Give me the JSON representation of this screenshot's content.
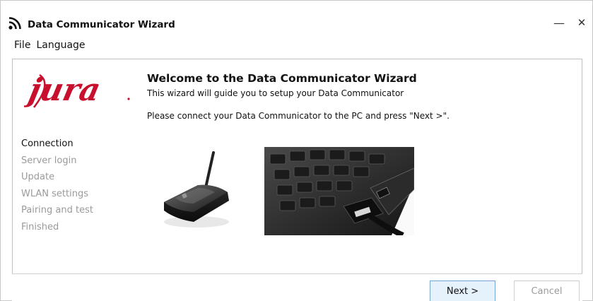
{
  "window": {
    "title": "Data Communicator Wizard",
    "icon": "rss-feed-icon",
    "minimize_glyph": "—",
    "close_glyph": "✕"
  },
  "menu": {
    "items": [
      "File",
      "Language"
    ]
  },
  "brand": {
    "logo_text": "jura",
    "logo_color": "#c8102e"
  },
  "wizard": {
    "heading": "Welcome to the Data Communicator Wizard",
    "subheading": "This wizard will guide you to setup your Data Communicator",
    "instruction": "Please connect your Data Communicator to the PC and press \"Next >\".",
    "steps": [
      {
        "label": "Connection",
        "active": true
      },
      {
        "label": "Server login",
        "active": false
      },
      {
        "label": "Update",
        "active": false
      },
      {
        "label": "WLAN settings",
        "active": false
      },
      {
        "label": "Pairing and test",
        "active": false
      },
      {
        "label": "Finished",
        "active": false
      }
    ]
  },
  "buttons": {
    "next_label": "Next >",
    "cancel_label": "Cancel"
  },
  "colors": {
    "accent_button_bg": "#e5f1fb",
    "accent_button_border": "#7aa7d1",
    "inactive_step": "#9a9a9a"
  }
}
